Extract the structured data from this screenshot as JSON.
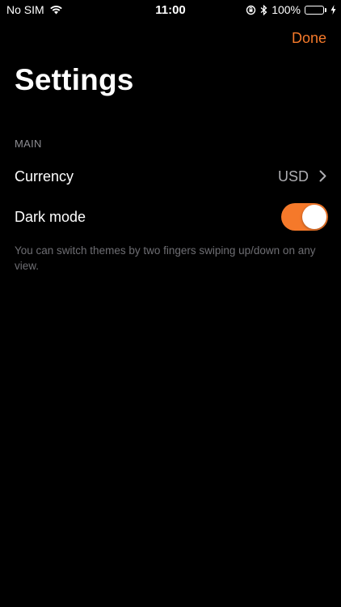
{
  "status_bar": {
    "carrier": "No SIM",
    "time": "11:00",
    "battery": "100%",
    "battery_level": 1.0,
    "icons": [
      "wifi-icon",
      "orientation-lock-icon",
      "bluetooth-icon",
      "battery-icon",
      "charging-bolt-icon"
    ]
  },
  "nav": {
    "done_label": "Done"
  },
  "page": {
    "title": "Settings"
  },
  "sections": {
    "main": {
      "header": "MAIN",
      "currency": {
        "label": "Currency",
        "value": "USD",
        "icon": "chevron-right-icon"
      },
      "dark_mode": {
        "label": "Dark mode",
        "enabled": true
      },
      "footer": "You can switch themes by two fingers swiping up/down on any view."
    }
  },
  "colors": {
    "accent": "#f5792a",
    "background": "#000000",
    "battery": "#4cd964"
  }
}
